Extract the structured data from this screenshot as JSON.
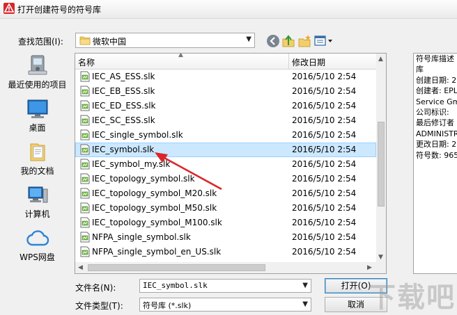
{
  "window": {
    "title": "打开创建符号的符号库"
  },
  "lookin": {
    "label": "查找范围(I):",
    "value": "微软中国"
  },
  "places": [
    {
      "label": "最近使用的项目",
      "icon": "recent-items-icon"
    },
    {
      "label": "桌面",
      "icon": "desktop-icon"
    },
    {
      "label": "我的文档",
      "icon": "documents-icon"
    },
    {
      "label": "计算机",
      "icon": "computer-icon"
    },
    {
      "label": "WPS网盘",
      "icon": "cloud-icon"
    }
  ],
  "list": {
    "col_name": "名称",
    "col_date": "修改日期",
    "selected_index": 5,
    "files": [
      {
        "name": "IEC_AS_ESS.slk",
        "date": "2016/5/10 2:54"
      },
      {
        "name": "IEC_EB_ESS.slk",
        "date": "2016/5/10 2:54"
      },
      {
        "name": "IEC_ED_ESS.slk",
        "date": "2016/5/10 2:54"
      },
      {
        "name": "IEC_SC_ESS.slk",
        "date": "2016/5/10 2:54"
      },
      {
        "name": "IEC_single_symbol.slk",
        "date": "2016/5/10 2:54"
      },
      {
        "name": "IEC_symbol.slk",
        "date": "2016/5/10 2:54"
      },
      {
        "name": "IEC_symbol_my.slk",
        "date": "2016/5/10 2:54"
      },
      {
        "name": "IEC_topology_symbol.slk",
        "date": "2016/5/10 2:54"
      },
      {
        "name": "IEC_topology_symbol_M20.slk",
        "date": "2016/5/10 2:54"
      },
      {
        "name": "IEC_topology_symbol_M50.slk",
        "date": "2016/5/10 2:54"
      },
      {
        "name": "IEC_topology_symbol_M100.slk",
        "date": "2016/5/10 2:54"
      },
      {
        "name": "NFPA_single_symbol.slk",
        "date": "2016/5/10 2:54"
      },
      {
        "name": "NFPA_single_symbol_en_US.slk",
        "date": "2016/5/10 2:54"
      }
    ]
  },
  "preview": {
    "lines": [
      "符号库描述",
      "库",
      "创建日期: 2",
      "创建者: EPL",
      "Service Gm",
      "公司标识:",
      "最后修订者",
      "ADMINISTR",
      "更改日期: 2",
      "符号数: 965"
    ]
  },
  "filename": {
    "label": "文件名(N):",
    "value": "IEC_symbol.slk"
  },
  "filetype": {
    "label": "文件类型(T):",
    "value": "符号库 (*.slk)"
  },
  "buttons": {
    "open": "打开(O)",
    "cancel": "取消"
  },
  "watermark": "下载吧",
  "colors": {
    "selection": "#cce8ff",
    "arrow": "#d9262c"
  }
}
